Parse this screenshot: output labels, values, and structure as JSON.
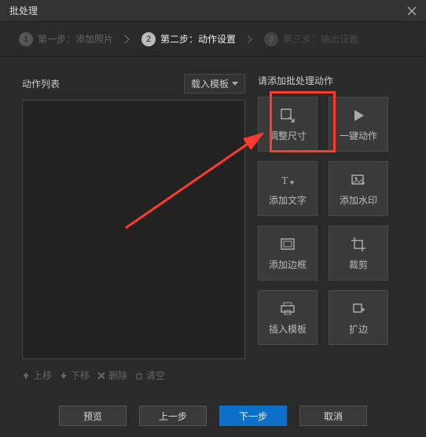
{
  "window": {
    "title": "批处理"
  },
  "steps": {
    "s1": {
      "num": "1",
      "label": "第一步：添加照片"
    },
    "s2": {
      "num": "2",
      "label": "第二步：动作设置"
    },
    "s3": {
      "num": "3",
      "label": "第三步：输出设置"
    }
  },
  "left": {
    "title": "动作列表",
    "load_template": "载入模板",
    "actions": {
      "up": "上移",
      "down": "下移",
      "delete": "删除",
      "clear": "清空"
    }
  },
  "right": {
    "title": "请添加批处理动作",
    "tiles": {
      "resize": "调整尺寸",
      "one_click": "一键动作",
      "add_text": "添加文字",
      "add_watermark": "添加水印",
      "add_border": "添加边框",
      "crop": "裁剪",
      "insert_template": "插入模板",
      "expand": "扩边"
    }
  },
  "footer": {
    "preview": "预览",
    "prev": "上一步",
    "next": "下一步",
    "cancel": "取消"
  }
}
